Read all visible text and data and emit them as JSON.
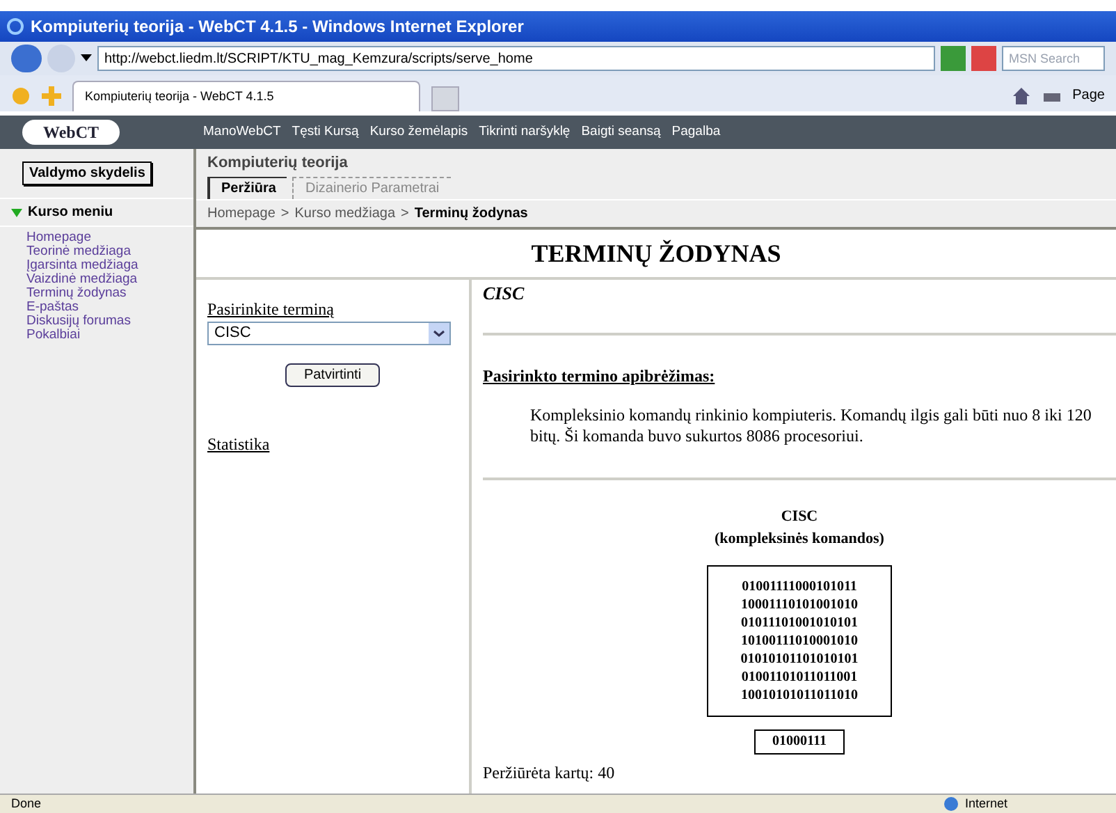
{
  "window": {
    "title": "Kompiuterių teorija - WebCT 4.1.5 - Windows Internet Explorer"
  },
  "address_bar": {
    "url": "http://webct.liedm.lt/SCRIPT/KTU_mag_Kemzura/scripts/serve_home",
    "search_placeholder": "MSN Search"
  },
  "browser_tab": {
    "title": "Kompiuterių teorija - WebCT 4.1.5"
  },
  "command_bar": {
    "page_label": "Page"
  },
  "webct_nav": {
    "logo": "WebCT",
    "links": [
      "ManoWebCT",
      "Tęsti Kursą",
      "Kurso žemėlapis",
      "Tikrinti naršyklę",
      "Baigti seansą",
      "Pagalba"
    ]
  },
  "control_panel_button": "Valdymo skydelis",
  "course_title": "Kompiuterių teorija",
  "view_tabs": [
    {
      "label": "Peržiūra",
      "selected": true
    },
    {
      "label": "Dizainerio Parametrai",
      "selected": false
    }
  ],
  "course_menu": {
    "title": "Kurso meniu",
    "expanded": true,
    "items": [
      "Homepage",
      "Teorinė medžiaga",
      "Įgarsinta medžiaga",
      "Vaizdinė medžiaga",
      "Terminų žodynas",
      "E-paštas",
      "Diskusijų forumas",
      "Pokalbiai"
    ]
  },
  "breadcrumb_separator": ">",
  "breadcrumb": [
    {
      "label": "Homepage",
      "current": false
    },
    {
      "label": "Kurso medžiaga",
      "current": false
    },
    {
      "label": "Terminų žodynas",
      "current": true
    }
  ],
  "page_title": "TERMINŲ ŽODYNAS",
  "term_form": {
    "label": "Pasirinkite terminą",
    "selected_term": "CISC",
    "submit": "Patvirtinti",
    "stats_link": "Statistika"
  },
  "term": {
    "name": "CISC",
    "definition_heading": "Pasirinkto termino apibrėžimas:",
    "definition": "Kompleksinio komandų rinkinio kompiuteris. Komandų ilgis gali būti nuo 8 iki 120 bitų. Ši komanda buvo sukurtos 8086 procesoriui.",
    "figure": {
      "title": "CISC",
      "subtitle": "(kompleksinės komandos)",
      "bits": [
        "01001111000101011",
        "10001110101001010",
        "01011101001010101",
        "10100111010001010",
        "01010101101010101",
        "01001101011011001",
        "10010101011011010"
      ],
      "register": "01000111"
    },
    "views": "Peržiūrėta kartų: 40"
  },
  "status_bar": {
    "text": "Done",
    "zone": "Internet"
  }
}
